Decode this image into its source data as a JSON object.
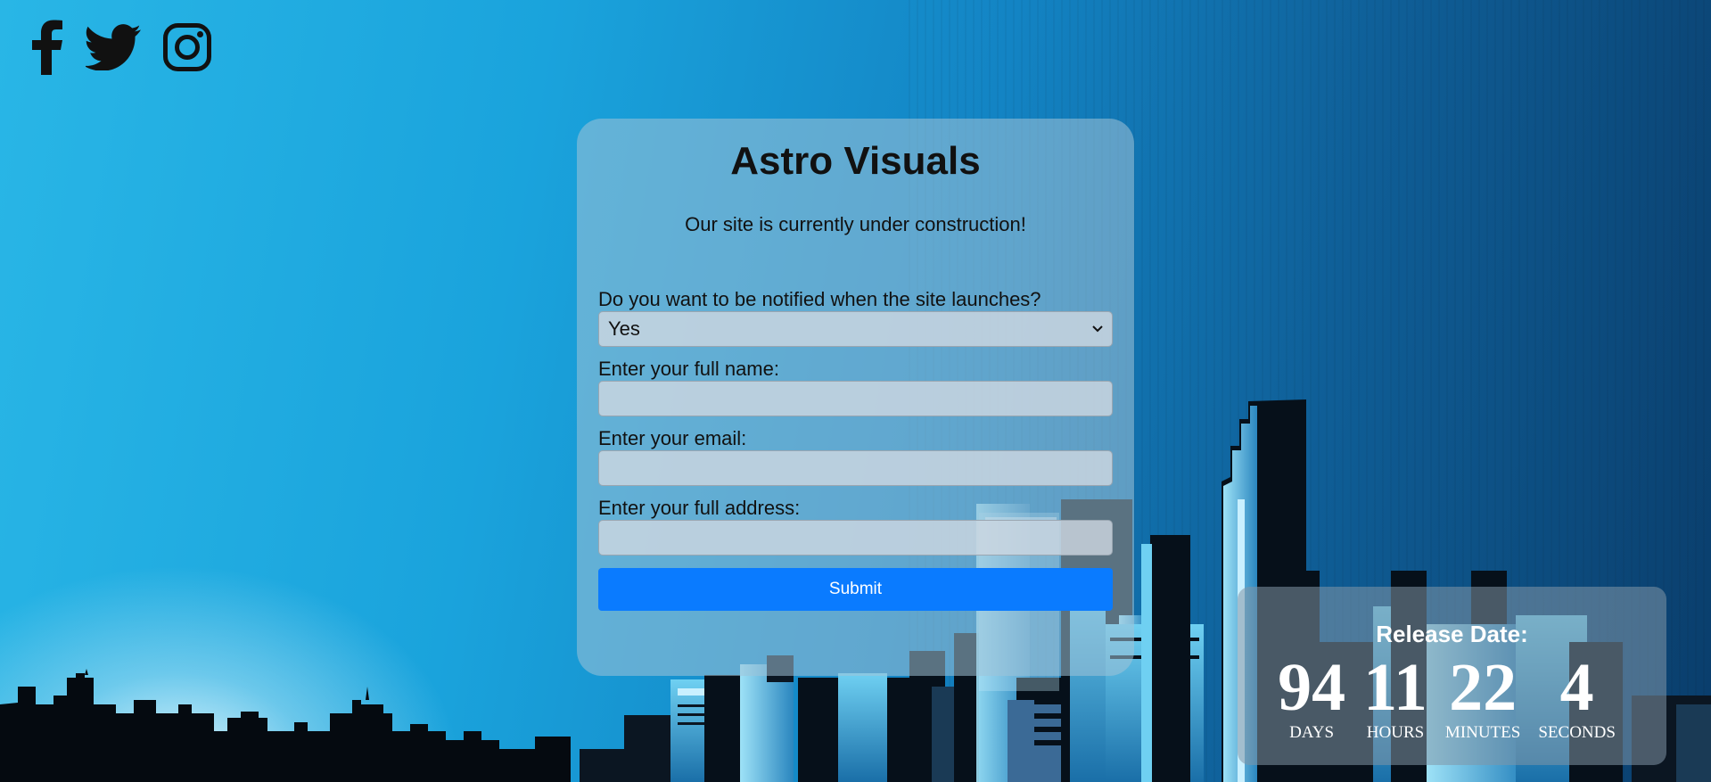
{
  "social": {
    "icons": [
      {
        "name": "facebook-icon"
      },
      {
        "name": "twitter-icon"
      },
      {
        "name": "instagram-icon"
      }
    ]
  },
  "card": {
    "title": "Astro Visuals",
    "subtitle": "Our site is currently under construction!"
  },
  "form": {
    "notify_label": "Do you want to be notified when the site launches?",
    "notify_value": "Yes",
    "name_label": "Enter your full name:",
    "name_value": "",
    "email_label": "Enter your email:",
    "email_value": "",
    "address_label": "Enter your full address:",
    "address_value": "",
    "submit_label": "Submit"
  },
  "release": {
    "title": "Release Date:",
    "days": "94",
    "days_label": "DAYS",
    "hours": "11",
    "hours_label": "HOURS",
    "minutes": "22",
    "minutes_label": "MINUTES",
    "seconds": "4",
    "seconds_label": "SECONDS"
  },
  "colors": {
    "accent": "#0a7bff",
    "sky_light": "#29b6e6",
    "sky_dark": "#0a3d6b"
  }
}
